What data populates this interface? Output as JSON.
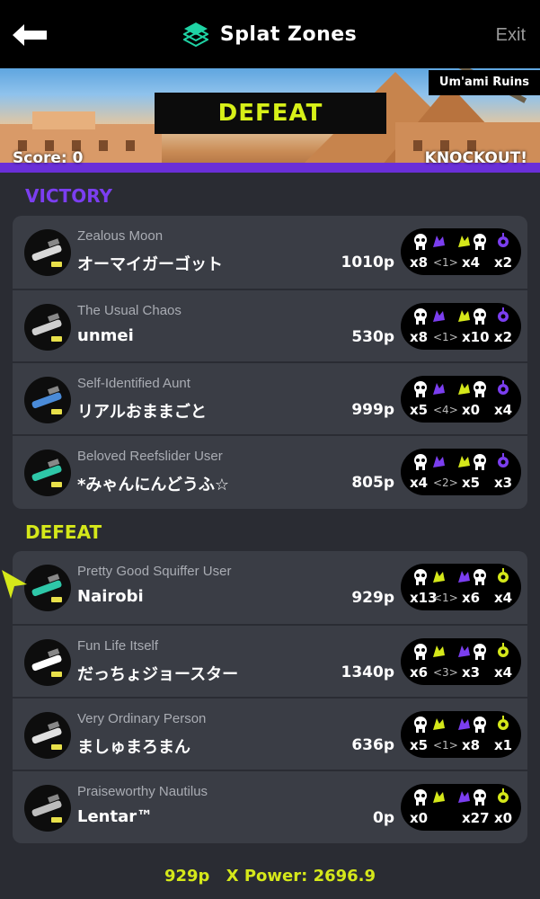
{
  "header": {
    "title": "Splat Zones",
    "exit_label": "Exit"
  },
  "banner": {
    "stage": "Um'ami Ruins",
    "result": "DEFEAT",
    "score": "Score: 0",
    "outcome": "KNOCKOUT!"
  },
  "colors": {
    "victory": "#7b3ef0",
    "defeat": "#d5e81a"
  },
  "teams": {
    "victory_label": "VICTORY",
    "defeat_label": "DEFEAT",
    "victory": [
      {
        "title": "Zealous Moon",
        "name": "オーマイガーゴット",
        "points": "1010p",
        "kills": "x8",
        "assists": "<1>",
        "deaths": "x4",
        "specials": "x2"
      },
      {
        "title": "The Usual Chaos",
        "name": "unmei",
        "points": "530p",
        "kills": "x8",
        "assists": "<1>",
        "deaths": "x10",
        "specials": "x2"
      },
      {
        "title": "Self-Identified Aunt",
        "name": "リアルおままごと",
        "points": "999p",
        "kills": "x5",
        "assists": "<4>",
        "deaths": "x0",
        "specials": "x4"
      },
      {
        "title": "Beloved Reefslider User",
        "name": "*みゃんにんどうふ☆",
        "points": "805p",
        "kills": "x4",
        "assists": "<2>",
        "deaths": "x5",
        "specials": "x3"
      }
    ],
    "defeat": [
      {
        "title": "Pretty Good Squiffer User",
        "name": "Nairobi",
        "points": "929p",
        "kills": "x13",
        "assists": "<1>",
        "deaths": "x6",
        "specials": "x4"
      },
      {
        "title": "Fun Life Itself",
        "name": "だっちょジョースター",
        "points": "1340p",
        "kills": "x6",
        "assists": "<3>",
        "deaths": "x3",
        "specials": "x4"
      },
      {
        "title": "Very Ordinary Person",
        "name": "ましゅまろまん",
        "points": "636p",
        "kills": "x5",
        "assists": "<1>",
        "deaths": "x8",
        "specials": "x1"
      },
      {
        "title": "Praiseworthy Nautilus",
        "name": "Lentar™",
        "points": "0p",
        "kills": "x0",
        "assists": "",
        "deaths": "x27",
        "specials": "x0"
      }
    ]
  },
  "footer": {
    "points": "929p",
    "xpower": "X Power: 2696.9"
  }
}
